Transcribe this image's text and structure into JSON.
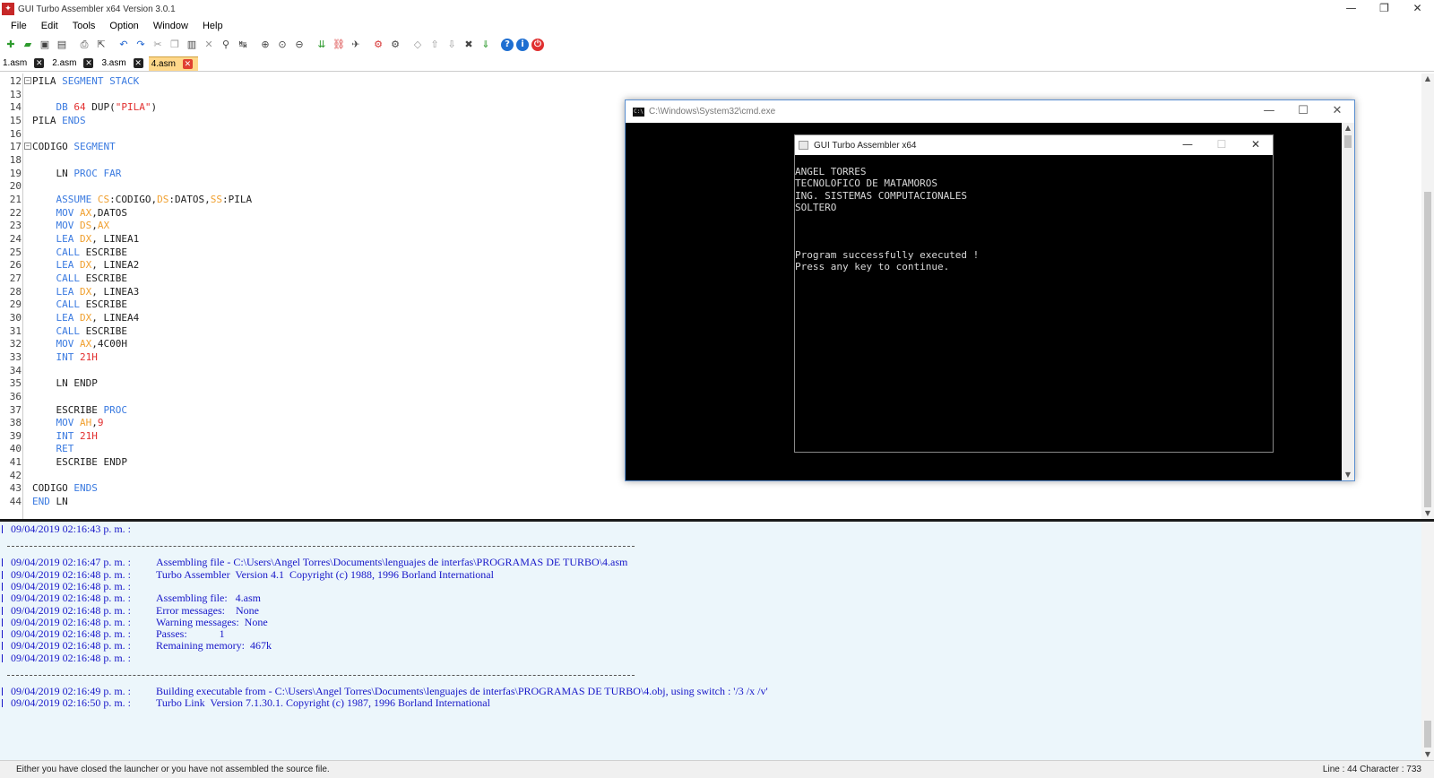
{
  "window": {
    "title": "GUI Turbo Assembler x64 Version 3.0.1",
    "app_icon": "tasm-logo-icon"
  },
  "window_controls": {
    "minimize": "—",
    "restore": "❐",
    "close": "✕"
  },
  "menu": [
    "File",
    "Edit",
    "Tools",
    "Option",
    "Window",
    "Help"
  ],
  "toolbar": [
    {
      "name": "new-file-icon",
      "glyph": "✚",
      "cls": "green"
    },
    {
      "name": "open-folder-icon",
      "glyph": "▰",
      "cls": "green"
    },
    {
      "name": "save-icon",
      "glyph": "▣",
      "cls": ""
    },
    {
      "name": "save-all-icon",
      "glyph": "▤",
      "cls": ""
    },
    {
      "sep": true
    },
    {
      "name": "print-icon",
      "glyph": "⎙",
      "cls": ""
    },
    {
      "name": "export-icon",
      "glyph": "⇱",
      "cls": ""
    },
    {
      "sep": true
    },
    {
      "name": "undo-icon",
      "glyph": "↶",
      "cls": "blue"
    },
    {
      "name": "redo-icon",
      "glyph": "↷",
      "cls": "blue"
    },
    {
      "name": "cut-icon",
      "glyph": "✂",
      "cls": "gray"
    },
    {
      "name": "copy-icon",
      "glyph": "❐",
      "cls": "gray"
    },
    {
      "name": "paste-icon",
      "glyph": "▥",
      "cls": ""
    },
    {
      "name": "delete-icon",
      "glyph": "✕",
      "cls": "gray"
    },
    {
      "name": "find-icon",
      "glyph": "⚲",
      "cls": ""
    },
    {
      "name": "replace-icon",
      "glyph": "↹",
      "cls": ""
    },
    {
      "sep": true
    },
    {
      "name": "zoom-in-icon",
      "glyph": "⊕",
      "cls": ""
    },
    {
      "name": "zoom-reset-icon",
      "glyph": "⊙",
      "cls": ""
    },
    {
      "name": "zoom-out-icon",
      "glyph": "⊖",
      "cls": ""
    },
    {
      "sep": true
    },
    {
      "name": "assemble-icon",
      "glyph": "⇊",
      "cls": "green"
    },
    {
      "name": "link-icon",
      "glyph": "⛓",
      "cls": "red"
    },
    {
      "name": "run-icon",
      "glyph": "✈",
      "cls": ""
    },
    {
      "sep": true
    },
    {
      "name": "debug-icon",
      "glyph": "⚙",
      "cls": "red"
    },
    {
      "name": "debug-all-icon",
      "glyph": "⚙",
      "cls": ""
    },
    {
      "sep": true
    },
    {
      "name": "code-icon",
      "glyph": "◇",
      "cls": "gray"
    },
    {
      "name": "arrow-up-icon",
      "glyph": "⇧",
      "cls": "gray"
    },
    {
      "name": "arrow-down-icon",
      "glyph": "⇩",
      "cls": "gray"
    },
    {
      "name": "tools-icon",
      "glyph": "✖",
      "cls": ""
    },
    {
      "name": "download-icon",
      "glyph": "⇓",
      "cls": "green"
    },
    {
      "sep": true
    },
    {
      "name": "help-icon",
      "glyph": "?",
      "cls": "circ b"
    },
    {
      "name": "info-icon",
      "glyph": "i",
      "cls": "circ b"
    },
    {
      "name": "power-icon",
      "glyph": "⏻",
      "cls": "circ r"
    }
  ],
  "tabs": [
    {
      "label": "1.asm",
      "active": false,
      "close": "✕"
    },
    {
      "label": "2.asm",
      "active": false,
      "close": "✕"
    },
    {
      "label": "3.asm",
      "active": false,
      "close": "✕"
    },
    {
      "label": "4.asm",
      "active": true,
      "close": "✕"
    }
  ],
  "code": [
    {
      "n": "12",
      "fold": "−",
      "t": [
        [
          "plain",
          "PILA "
        ],
        [
          "kw",
          "SEGMENT STACK"
        ]
      ]
    },
    {
      "n": "13",
      "t": []
    },
    {
      "n": "14",
      "t": [
        [
          "plain",
          "    "
        ],
        [
          "kw",
          "DB "
        ],
        [
          "num",
          "64"
        ],
        [
          "plain",
          " DUP("
        ],
        [
          "str",
          "\"PILA\""
        ],
        [
          "plain",
          ")"
        ]
      ]
    },
    {
      "n": "15",
      "t": [
        [
          "plain",
          "PILA "
        ],
        [
          "kw",
          "ENDS"
        ]
      ]
    },
    {
      "n": "16",
      "t": []
    },
    {
      "n": "17",
      "fold": "−",
      "t": [
        [
          "plain",
          "CODIGO "
        ],
        [
          "kw",
          "SEGMENT"
        ]
      ]
    },
    {
      "n": "18",
      "t": []
    },
    {
      "n": "19",
      "t": [
        [
          "plain",
          "    LN "
        ],
        [
          "kw",
          "PROC FAR"
        ]
      ]
    },
    {
      "n": "20",
      "t": []
    },
    {
      "n": "21",
      "t": [
        [
          "plain",
          "    "
        ],
        [
          "kw",
          "ASSUME "
        ],
        [
          "reg",
          "CS"
        ],
        [
          "plain",
          ":CODIGO,"
        ],
        [
          "reg",
          "DS"
        ],
        [
          "plain",
          ":DATOS,"
        ],
        [
          "reg",
          "SS"
        ],
        [
          "plain",
          ":PILA"
        ]
      ]
    },
    {
      "n": "22",
      "t": [
        [
          "plain",
          "    "
        ],
        [
          "kw",
          "MOV "
        ],
        [
          "reg",
          "AX"
        ],
        [
          "plain",
          ",DATOS"
        ]
      ]
    },
    {
      "n": "23",
      "t": [
        [
          "plain",
          "    "
        ],
        [
          "kw",
          "MOV "
        ],
        [
          "reg",
          "DS"
        ],
        [
          "plain",
          ","
        ],
        [
          "reg",
          "AX"
        ]
      ]
    },
    {
      "n": "24",
      "t": [
        [
          "plain",
          "    "
        ],
        [
          "kw",
          "LEA "
        ],
        [
          "reg",
          "DX"
        ],
        [
          "plain",
          ", LINEA1"
        ]
      ]
    },
    {
      "n": "25",
      "t": [
        [
          "plain",
          "    "
        ],
        [
          "kw",
          "CALL "
        ],
        [
          "plain",
          "ESCRIBE"
        ]
      ]
    },
    {
      "n": "26",
      "t": [
        [
          "plain",
          "    "
        ],
        [
          "kw",
          "LEA "
        ],
        [
          "reg",
          "DX"
        ],
        [
          "plain",
          ", LINEA2"
        ]
      ]
    },
    {
      "n": "27",
      "t": [
        [
          "plain",
          "    "
        ],
        [
          "kw",
          "CALL "
        ],
        [
          "plain",
          "ESCRIBE"
        ]
      ]
    },
    {
      "n": "28",
      "t": [
        [
          "plain",
          "    "
        ],
        [
          "kw",
          "LEA "
        ],
        [
          "reg",
          "DX"
        ],
        [
          "plain",
          ", LINEA3"
        ]
      ]
    },
    {
      "n": "29",
      "t": [
        [
          "plain",
          "    "
        ],
        [
          "kw",
          "CALL "
        ],
        [
          "plain",
          "ESCRIBE"
        ]
      ]
    },
    {
      "n": "30",
      "t": [
        [
          "plain",
          "    "
        ],
        [
          "kw",
          "LEA "
        ],
        [
          "reg",
          "DX"
        ],
        [
          "plain",
          ", LINEA4"
        ]
      ]
    },
    {
      "n": "31",
      "t": [
        [
          "plain",
          "    "
        ],
        [
          "kw",
          "CALL "
        ],
        [
          "plain",
          "ESCRIBE"
        ]
      ]
    },
    {
      "n": "32",
      "t": [
        [
          "plain",
          "    "
        ],
        [
          "kw",
          "MOV "
        ],
        [
          "reg",
          "AX"
        ],
        [
          "plain",
          ",4C00H"
        ]
      ]
    },
    {
      "n": "33",
      "t": [
        [
          "plain",
          "    "
        ],
        [
          "kw",
          "INT "
        ],
        [
          "num",
          "21H"
        ]
      ]
    },
    {
      "n": "34",
      "t": []
    },
    {
      "n": "35",
      "t": [
        [
          "plain",
          "    LN ENDP"
        ]
      ]
    },
    {
      "n": "36",
      "t": []
    },
    {
      "n": "37",
      "t": [
        [
          "plain",
          "    ESCRIBE "
        ],
        [
          "kw",
          "PROC"
        ]
      ]
    },
    {
      "n": "38",
      "t": [
        [
          "plain",
          "    "
        ],
        [
          "kw",
          "MOV "
        ],
        [
          "reg",
          "AH"
        ],
        [
          "plain",
          ","
        ],
        [
          "num",
          "9"
        ]
      ]
    },
    {
      "n": "39",
      "t": [
        [
          "plain",
          "    "
        ],
        [
          "kw",
          "INT "
        ],
        [
          "num",
          "21H"
        ]
      ]
    },
    {
      "n": "40",
      "t": [
        [
          "plain",
          "    "
        ],
        [
          "kw",
          "RET"
        ]
      ]
    },
    {
      "n": "41",
      "t": [
        [
          "plain",
          "    ESCRIBE ENDP"
        ]
      ]
    },
    {
      "n": "42",
      "t": []
    },
    {
      "n": "43",
      "t": [
        [
          "plain",
          "CODIGO "
        ],
        [
          "kw",
          "ENDS"
        ]
      ]
    },
    {
      "n": "44",
      "t": [
        [
          "kw",
          "END "
        ],
        [
          "plain",
          "LN"
        ]
      ]
    }
  ],
  "scroll_arrows": {
    "up": "▲",
    "down": "▼"
  },
  "cmd": {
    "title": "C:\\Windows\\System32\\cmd.exe",
    "icon_text": "C:\\",
    "inner_title": "GUI Turbo Assembler x64",
    "console_lines": [
      "ANGEL TORRES",
      "TECNOLOFICO DE MATAMOROS",
      "ING. SISTEMAS COMPUTACIONALES",
      "SOLTERO",
      "",
      "",
      "",
      "Program successfully executed !",
      "Press any key to continue."
    ]
  },
  "log": [
    {
      "type": "line",
      "ts": "09/04/2019 02:16:43 p. m. :",
      "msg": ""
    },
    {
      "type": "gap"
    },
    {
      "type": "sep"
    },
    {
      "type": "line",
      "ts": "09/04/2019 02:16:47 p. m. :",
      "msg": "Assembling file - C:\\Users\\Angel Torres\\Documents\\lenguajes de interfas\\PROGRAMAS DE TURBO\\4.asm"
    },
    {
      "type": "line",
      "ts": "09/04/2019 02:16:48 p. m. :",
      "msg": "Turbo Assembler  Version 4.1  Copyright (c) 1988, 1996 Borland International"
    },
    {
      "type": "line",
      "ts": "09/04/2019 02:16:48 p. m. :",
      "msg": ""
    },
    {
      "type": "line",
      "ts": "09/04/2019 02:16:48 p. m. :",
      "msg": "Assembling file:   4.asm"
    },
    {
      "type": "line",
      "ts": "09/04/2019 02:16:48 p. m. :",
      "msg": "Error messages:    None"
    },
    {
      "type": "line",
      "ts": "09/04/2019 02:16:48 p. m. :",
      "msg": "Warning messages:  None"
    },
    {
      "type": "line",
      "ts": "09/04/2019 02:16:48 p. m. :",
      "msg": "Passes:            1"
    },
    {
      "type": "line",
      "ts": "09/04/2019 02:16:48 p. m. :",
      "msg": "Remaining memory:  467k"
    },
    {
      "type": "line",
      "ts": "09/04/2019 02:16:48 p. m. :",
      "msg": ""
    },
    {
      "type": "gap"
    },
    {
      "type": "sep"
    },
    {
      "type": "line",
      "ts": "09/04/2019 02:16:49 p. m. :",
      "msg": "Building executable from - C:\\Users\\Angel Torres\\Documents\\lenguajes de interfas\\PROGRAMAS DE TURBO\\4.obj, using switch : '/3 /x /v'"
    },
    {
      "type": "line",
      "ts": "09/04/2019 02:16:50 p. m. :",
      "msg": "Turbo Link  Version 7.1.30.1. Copyright (c) 1987, 1996 Borland International"
    }
  ],
  "status": {
    "message": "Either you have closed the launcher or you have not assembled the source file.",
    "position": "Line : 44 Character : 733"
  }
}
